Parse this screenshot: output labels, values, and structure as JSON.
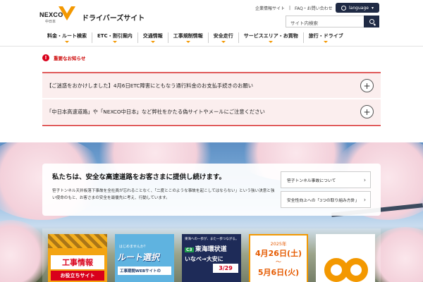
{
  "header": {
    "logo_text": "NEXCO",
    "logo_sub": "中日本",
    "site_name": "ドライバーズサイト",
    "util_links": [
      "企業情報サイト",
      "FAQ・お問い合わせ"
    ],
    "language_label": "language",
    "search_placeholder": "サイト内検索"
  },
  "nav": {
    "items": [
      "料金・ルート検索",
      "ETC・割引案内",
      "交通情報",
      "工事規制情報",
      "安全走行",
      "サービスエリア・お買物",
      "旅行・ドライブ"
    ]
  },
  "notices": {
    "heading": "重要なお知らせ",
    "items": [
      "【ご迷惑をおかけしました】4月6日ETC障害にともなう通行料金のお支払手続きのお願い",
      "「中日本高速道路」や「NEXCO中日本」など弊社をかたる偽サイトやメールにご注意ください"
    ]
  },
  "mission": {
    "title": "私たちは、安全な高速道路をお客さまに提供し続けます。",
    "body": "笹子トンネル天井板落下事故を全社員が忘れることなく、「二度とこのような事故を起こしてはならない」という強い決意と強い使命のもと、お客さまの安全を最優先に考え、行動しています。",
    "links": [
      "笹子トンネル事故について",
      "安全性向上への「3つの取り組み方針」"
    ]
  },
  "banners": {
    "b1": {
      "title": "工事情報",
      "sub": "お役立ちサイト"
    },
    "b2": {
      "top": "はじめませんか？",
      "big": "ルート選択",
      "sub": "工事期間WEBサイトの"
    },
    "b3": {
      "top": "東海への一歩が、また一歩つながる。",
      "line": "C3",
      "name": "東海環状道",
      "mid": "いなべ→大安に",
      "date": "3/29"
    },
    "b4": {
      "year": "2025年",
      "date1": "4月26日(土)",
      "sep": "〜",
      "date2": "5月6日(火)"
    },
    "b5": {}
  },
  "colors": {
    "brand_orange": "#f39800",
    "navy": "#1f2a44",
    "alert_red": "#d9001b"
  }
}
